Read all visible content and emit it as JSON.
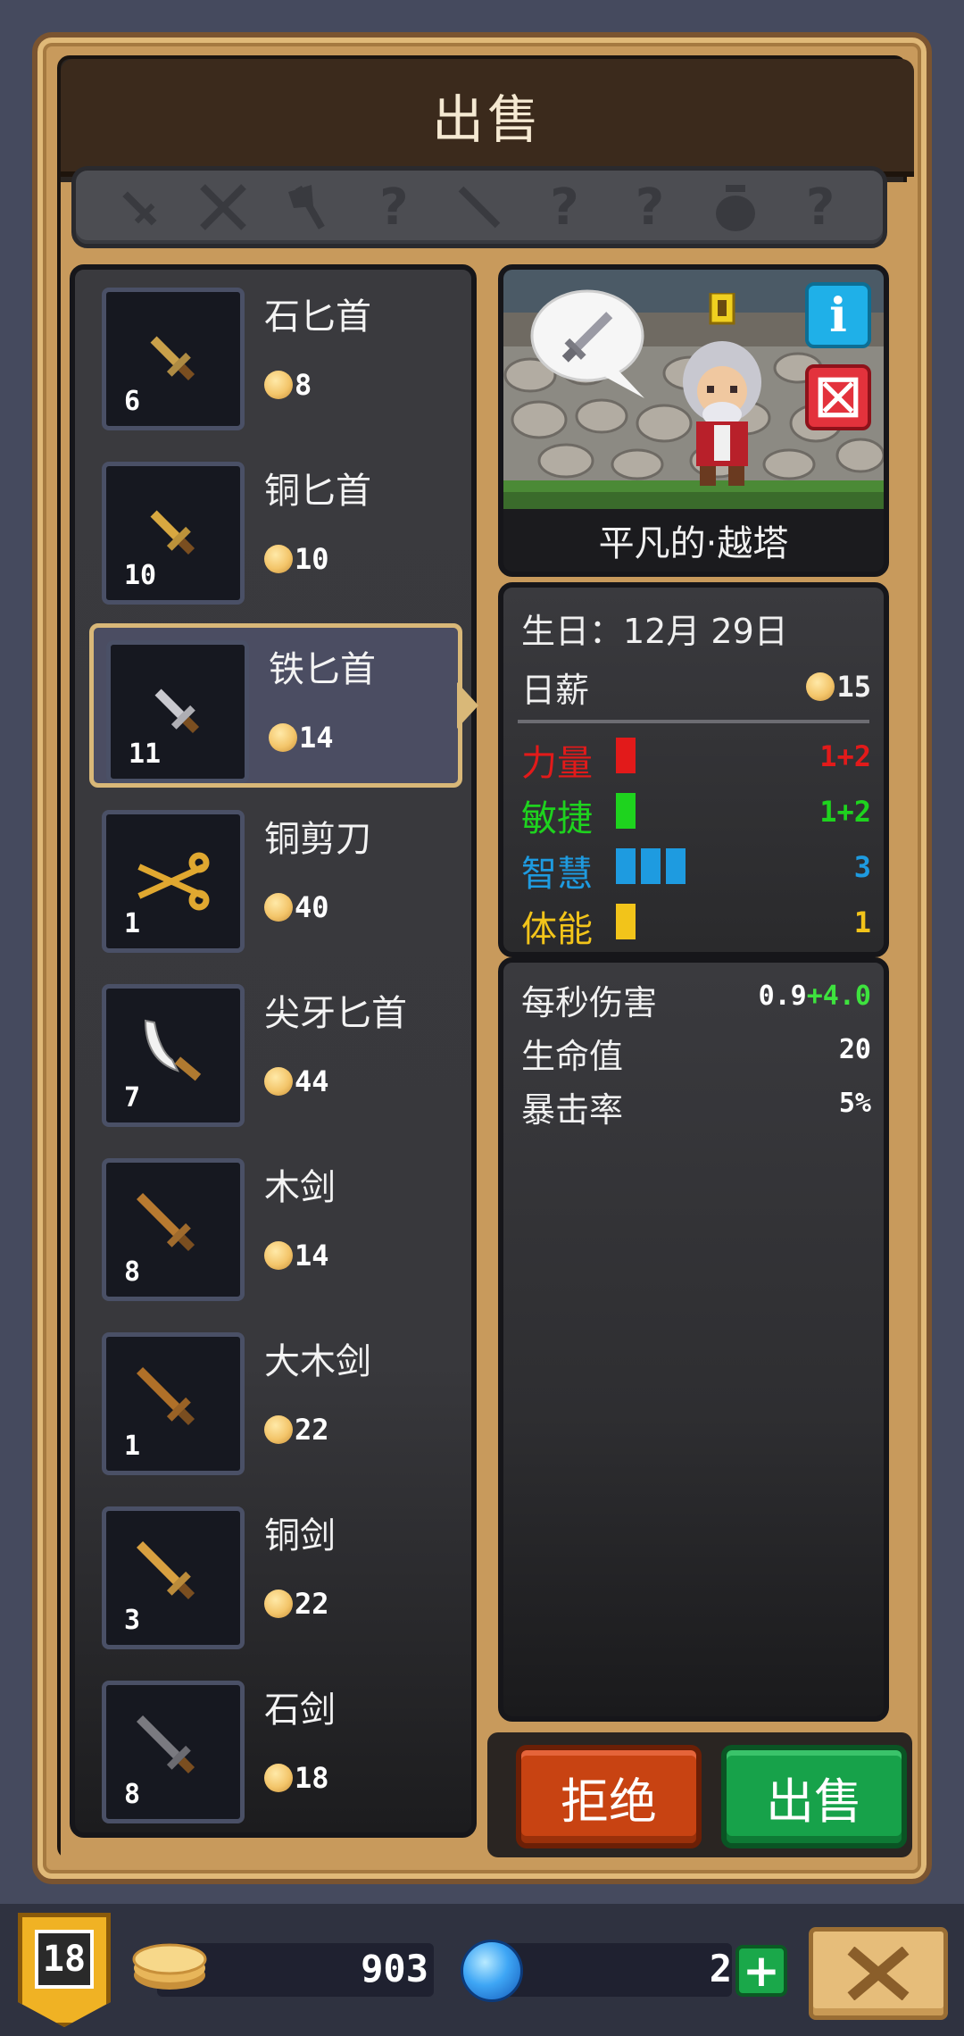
{
  "title": "出售",
  "filter_icons": [
    "dagger-icon",
    "sword-icon",
    "axe-icon",
    "unknown-category-icon",
    "spear-icon",
    "unknown-category-icon",
    "unknown-category-icon",
    "pot-icon",
    "unknown-category-icon"
  ],
  "unknown_glyph": "?",
  "items": [
    {
      "name": "石匕首",
      "qty": "6",
      "price": "8",
      "color": "#c9a04a",
      "icon": "dagger-icon",
      "selected": false
    },
    {
      "name": "铜匕首",
      "qty": "10",
      "price": "10",
      "color": "#d8a840",
      "icon": "dagger-icon",
      "selected": false
    },
    {
      "name": "铁匕首",
      "qty": "11",
      "price": "14",
      "color": "#c9c9cf",
      "icon": "dagger-icon",
      "selected": true
    },
    {
      "name": "铜剪刀",
      "qty": "1",
      "price": "40",
      "color": "#e0a830",
      "icon": "scissors-icon",
      "selected": false
    },
    {
      "name": "尖牙匕首",
      "qty": "7",
      "price": "44",
      "color": "#f2f2f2",
      "icon": "fang-dagger-icon",
      "selected": false
    },
    {
      "name": "木剑",
      "qty": "8",
      "price": "14",
      "color": "#b87a30",
      "icon": "sword-icon",
      "selected": false
    },
    {
      "name": "大木剑",
      "qty": "1",
      "price": "22",
      "color": "#b07028",
      "icon": "sword-icon",
      "selected": false
    },
    {
      "name": "铜剑",
      "qty": "3",
      "price": "22",
      "color": "#d8a040",
      "icon": "sword-icon",
      "selected": false
    },
    {
      "name": "石剑",
      "qty": "8",
      "price": "18",
      "color": "#7a7a80",
      "icon": "sword-icon",
      "selected": false
    }
  ],
  "hero": {
    "name": "平凡的·越塔",
    "info_label": "i",
    "birthday": "生日：12月 29日",
    "wage_label": "日薪",
    "wage_value": "15"
  },
  "attributes": [
    {
      "label": "力量",
      "color": "#e21a1a",
      "bars": 1,
      "value": "1+2"
    },
    {
      "label": "敏捷",
      "color": "#1ed31e",
      "bars": 1,
      "value": "1+2"
    },
    {
      "label": "智慧",
      "color": "#1e9be0",
      "bars": 3,
      "value": "3"
    },
    {
      "label": "体能",
      "color": "#f2c41a",
      "bars": 1,
      "value": "1"
    }
  ],
  "details": [
    {
      "label": "每秒伤害",
      "value": "0.9",
      "bonus": "+4.0"
    },
    {
      "label": "生命值",
      "value": "20",
      "bonus": ""
    },
    {
      "label": "暴击率",
      "value": "5%",
      "bonus": ""
    }
  ],
  "actions": {
    "reject_label": "拒绝",
    "sell_label": "出售"
  },
  "status": {
    "level": "18",
    "gold": "903",
    "gems": "2",
    "gem_plus": "+"
  }
}
